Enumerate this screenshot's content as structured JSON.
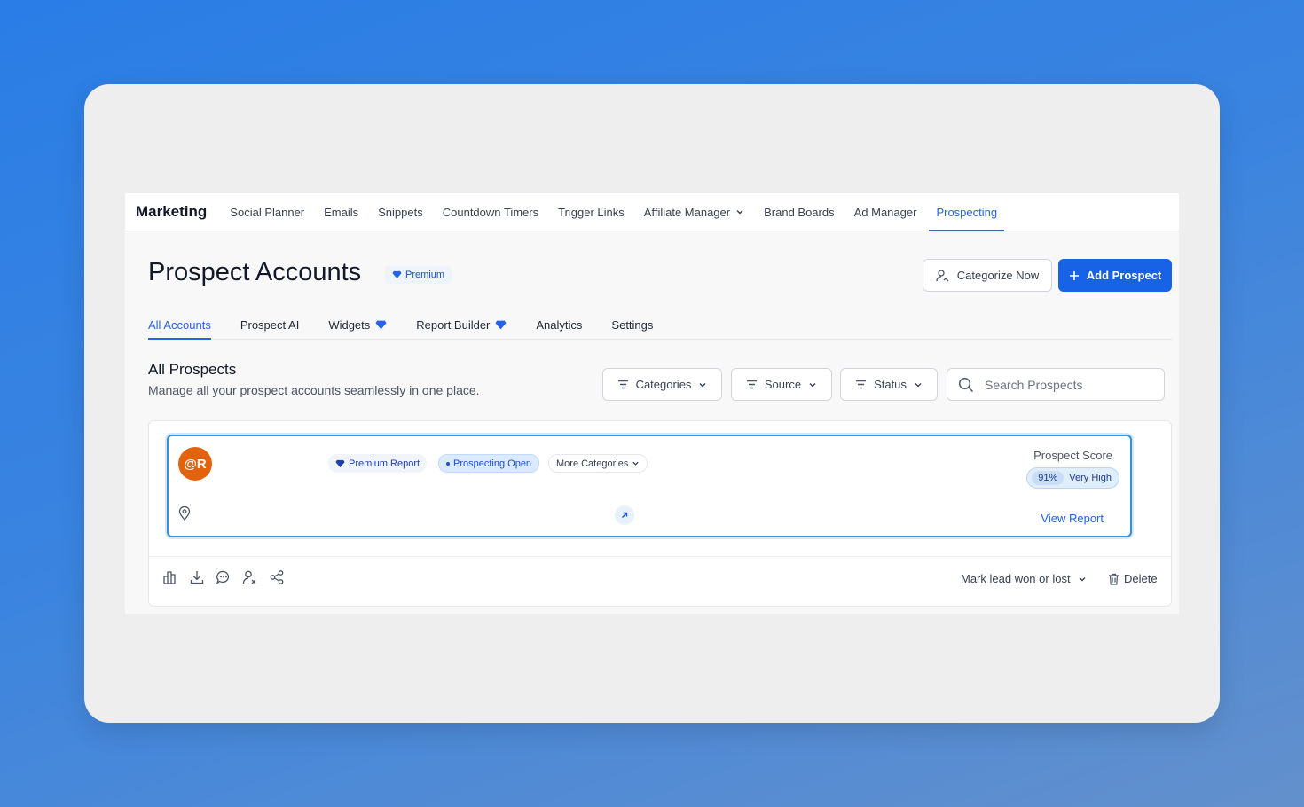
{
  "nav": {
    "brand": "Marketing",
    "items": [
      {
        "label": "Social Planner"
      },
      {
        "label": "Emails"
      },
      {
        "label": "Snippets"
      },
      {
        "label": "Countdown Timers"
      },
      {
        "label": "Trigger Links"
      },
      {
        "label": "Affiliate Manager"
      },
      {
        "label": "Brand Boards"
      },
      {
        "label": "Ad Manager"
      },
      {
        "label": "Prospecting"
      }
    ],
    "active": "Prospecting"
  },
  "header": {
    "title": "Prospect Accounts",
    "badge": "Premium",
    "categorize_label": "Categorize Now",
    "add_label": "Add Prospect"
  },
  "subtabs": [
    {
      "label": "All Accounts"
    },
    {
      "label": "Prospect AI"
    },
    {
      "label": "Widgets"
    },
    {
      "label": "Report Builder"
    },
    {
      "label": "Analytics"
    },
    {
      "label": "Settings"
    }
  ],
  "section": {
    "title": "All Prospects",
    "subtitle": "Manage all your prospect accounts seamlessly in one place."
  },
  "filters": {
    "categories": "Categories",
    "source": "Source",
    "status": "Status"
  },
  "search": {
    "placeholder": "Search Prospects",
    "value": ""
  },
  "card": {
    "avatar_text": "@R",
    "tags": {
      "premium": "Premium Report",
      "open": "Prospecting Open",
      "more": "More Categories"
    },
    "score_label": "Prospect Score",
    "score_pct": "91%",
    "score_level": "Very High",
    "view_report": "View Report"
  },
  "footer": {
    "mark_lead": "Mark lead won or lost",
    "delete": "Delete"
  },
  "colors": {
    "accent": "#1762e5",
    "avatar": "#e2620e",
    "card_border": "#2f93e0"
  }
}
